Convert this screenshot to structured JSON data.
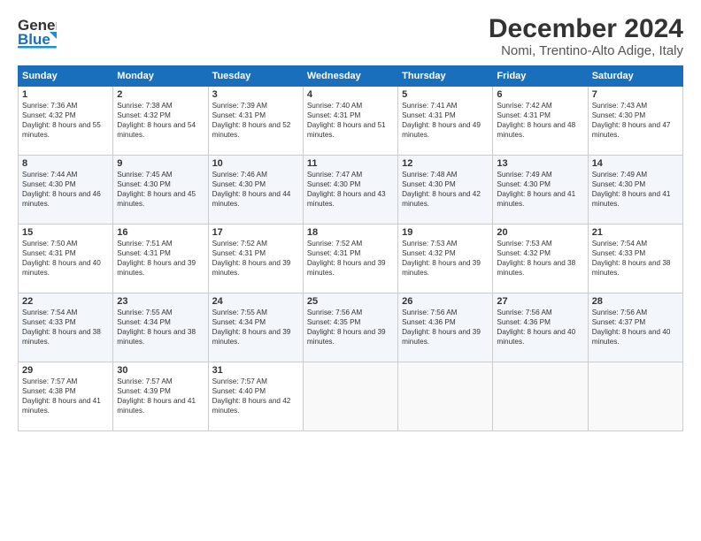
{
  "logo": {
    "line1": "General",
    "line2": "Blue"
  },
  "header": {
    "title": "December 2024",
    "subtitle": "Nomi, Trentino-Alto Adige, Italy"
  },
  "weekdays": [
    "Sunday",
    "Monday",
    "Tuesday",
    "Wednesday",
    "Thursday",
    "Friday",
    "Saturday"
  ],
  "weeks": [
    [
      {
        "day": "1",
        "sunrise": "7:36 AM",
        "sunset": "4:32 PM",
        "daylight": "8 hours and 55 minutes."
      },
      {
        "day": "2",
        "sunrise": "7:38 AM",
        "sunset": "4:32 PM",
        "daylight": "8 hours and 54 minutes."
      },
      {
        "day": "3",
        "sunrise": "7:39 AM",
        "sunset": "4:31 PM",
        "daylight": "8 hours and 52 minutes."
      },
      {
        "day": "4",
        "sunrise": "7:40 AM",
        "sunset": "4:31 PM",
        "daylight": "8 hours and 51 minutes."
      },
      {
        "day": "5",
        "sunrise": "7:41 AM",
        "sunset": "4:31 PM",
        "daylight": "8 hours and 49 minutes."
      },
      {
        "day": "6",
        "sunrise": "7:42 AM",
        "sunset": "4:31 PM",
        "daylight": "8 hours and 48 minutes."
      },
      {
        "day": "7",
        "sunrise": "7:43 AM",
        "sunset": "4:30 PM",
        "daylight": "8 hours and 47 minutes."
      }
    ],
    [
      {
        "day": "8",
        "sunrise": "7:44 AM",
        "sunset": "4:30 PM",
        "daylight": "8 hours and 46 minutes."
      },
      {
        "day": "9",
        "sunrise": "7:45 AM",
        "sunset": "4:30 PM",
        "daylight": "8 hours and 45 minutes."
      },
      {
        "day": "10",
        "sunrise": "7:46 AM",
        "sunset": "4:30 PM",
        "daylight": "8 hours and 44 minutes."
      },
      {
        "day": "11",
        "sunrise": "7:47 AM",
        "sunset": "4:30 PM",
        "daylight": "8 hours and 43 minutes."
      },
      {
        "day": "12",
        "sunrise": "7:48 AM",
        "sunset": "4:30 PM",
        "daylight": "8 hours and 42 minutes."
      },
      {
        "day": "13",
        "sunrise": "7:49 AM",
        "sunset": "4:30 PM",
        "daylight": "8 hours and 41 minutes."
      },
      {
        "day": "14",
        "sunrise": "7:49 AM",
        "sunset": "4:30 PM",
        "daylight": "8 hours and 41 minutes."
      }
    ],
    [
      {
        "day": "15",
        "sunrise": "7:50 AM",
        "sunset": "4:31 PM",
        "daylight": "8 hours and 40 minutes."
      },
      {
        "day": "16",
        "sunrise": "7:51 AM",
        "sunset": "4:31 PM",
        "daylight": "8 hours and 39 minutes."
      },
      {
        "day": "17",
        "sunrise": "7:52 AM",
        "sunset": "4:31 PM",
        "daylight": "8 hours and 39 minutes."
      },
      {
        "day": "18",
        "sunrise": "7:52 AM",
        "sunset": "4:31 PM",
        "daylight": "8 hours and 39 minutes."
      },
      {
        "day": "19",
        "sunrise": "7:53 AM",
        "sunset": "4:32 PM",
        "daylight": "8 hours and 39 minutes."
      },
      {
        "day": "20",
        "sunrise": "7:53 AM",
        "sunset": "4:32 PM",
        "daylight": "8 hours and 38 minutes."
      },
      {
        "day": "21",
        "sunrise": "7:54 AM",
        "sunset": "4:33 PM",
        "daylight": "8 hours and 38 minutes."
      }
    ],
    [
      {
        "day": "22",
        "sunrise": "7:54 AM",
        "sunset": "4:33 PM",
        "daylight": "8 hours and 38 minutes."
      },
      {
        "day": "23",
        "sunrise": "7:55 AM",
        "sunset": "4:34 PM",
        "daylight": "8 hours and 38 minutes."
      },
      {
        "day": "24",
        "sunrise": "7:55 AM",
        "sunset": "4:34 PM",
        "daylight": "8 hours and 39 minutes."
      },
      {
        "day": "25",
        "sunrise": "7:56 AM",
        "sunset": "4:35 PM",
        "daylight": "8 hours and 39 minutes."
      },
      {
        "day": "26",
        "sunrise": "7:56 AM",
        "sunset": "4:36 PM",
        "daylight": "8 hours and 39 minutes."
      },
      {
        "day": "27",
        "sunrise": "7:56 AM",
        "sunset": "4:36 PM",
        "daylight": "8 hours and 40 minutes."
      },
      {
        "day": "28",
        "sunrise": "7:56 AM",
        "sunset": "4:37 PM",
        "daylight": "8 hours and 40 minutes."
      }
    ],
    [
      {
        "day": "29",
        "sunrise": "7:57 AM",
        "sunset": "4:38 PM",
        "daylight": "8 hours and 41 minutes."
      },
      {
        "day": "30",
        "sunrise": "7:57 AM",
        "sunset": "4:39 PM",
        "daylight": "8 hours and 41 minutes."
      },
      {
        "day": "31",
        "sunrise": "7:57 AM",
        "sunset": "4:40 PM",
        "daylight": "8 hours and 42 minutes."
      },
      null,
      null,
      null,
      null
    ]
  ],
  "labels": {
    "sunrise": "Sunrise:",
    "sunset": "Sunset:",
    "daylight": "Daylight:"
  }
}
